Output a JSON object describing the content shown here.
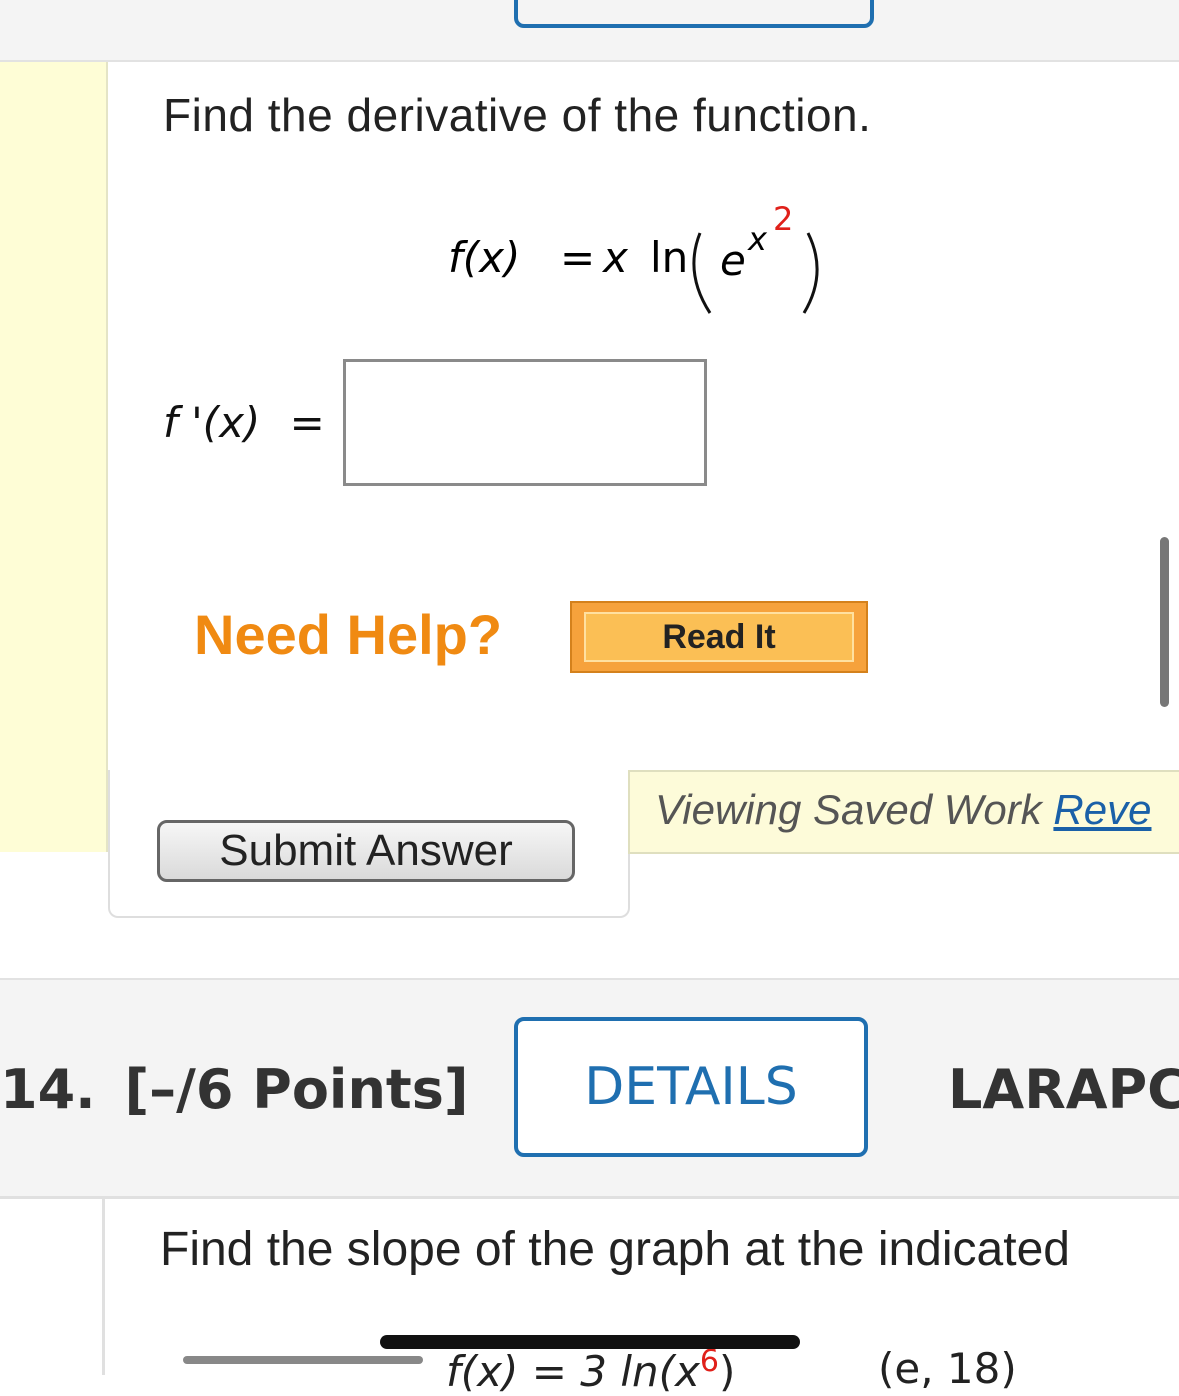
{
  "question13": {
    "prompt": "Find the derivative of the function.",
    "function": {
      "lhs": "f(x)",
      "equals": "=",
      "coef": "x",
      "ln": "ln",
      "base": "e",
      "exp_var": "x",
      "exp_power": "2"
    },
    "derivative_label": {
      "name": "f '(x)",
      "equals": "="
    },
    "answer_value": "",
    "need_help": "Need Help?",
    "read_it": "Read It",
    "submit": "Submit Answer",
    "saved_work": "Viewing Saved Work",
    "revert": "Reve"
  },
  "question14": {
    "number": "14.",
    "points": "[–/6 Points]",
    "details": "DETAILS",
    "code": "LARAPC",
    "prompt": "Find the slope of the graph at the indicated",
    "eq_fragment": "f(x) = 3 ln(x",
    "eq_power": "6",
    "eq_close": ")",
    "point_fragment": "(e, 18)"
  },
  "colors": {
    "accent_blue": "#1f6fb0",
    "help_orange": "#f08a12",
    "exponent_red": "#e0201a",
    "margin_yellow": "#fefdd6"
  }
}
